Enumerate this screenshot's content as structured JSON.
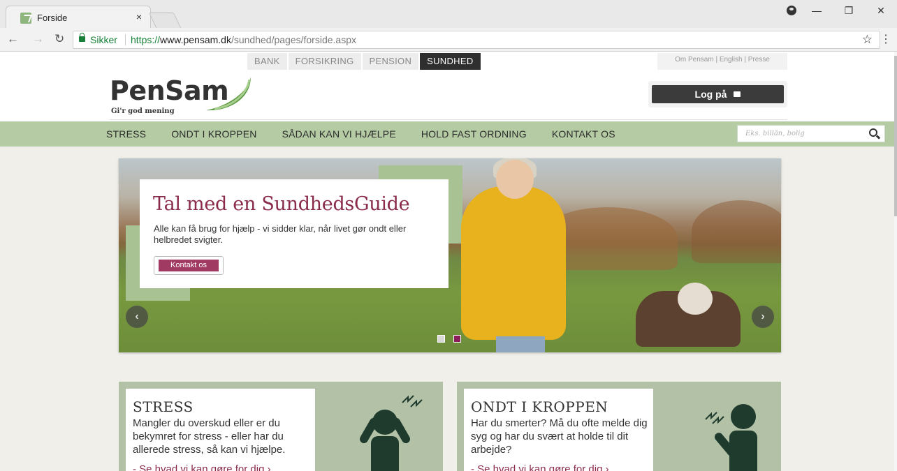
{
  "browser": {
    "tab_title": "Forside",
    "tab_close": "×",
    "secure_label": "Sikker",
    "url_scheme": "https://",
    "url_host": "www.pensam.dk",
    "url_path": "/sundhed/pages/forside.aspx",
    "window_controls": [
      "—",
      "❐",
      "✕"
    ]
  },
  "site": {
    "topnav": [
      "BANK",
      "FORSIKRING",
      "PENSION",
      "SUNDHED"
    ],
    "topnav_active": "SUNDHED",
    "utility_links": "Om Pensam  |  English  |  Presse",
    "logo_text": "PenSam",
    "logo_tagline": "Gi'r god mening",
    "login_label": "Log på",
    "mainnav": [
      "STRESS",
      "ONDT I KROPPEN",
      "SÅDAN KAN VI HJÆLPE",
      "HOLD FAST ORDNING",
      "KONTAKT OS"
    ],
    "search_placeholder": "Eks. billån, bolig"
  },
  "hero": {
    "title": "Tal med en SundhedsGuide",
    "text": "Alle kan få brug for hjælp - vi sidder klar, når livet gør ondt eller helbredet svigter.",
    "button": "Kontakt os",
    "active_slide": 2,
    "slide_count": 2
  },
  "cards": [
    {
      "title": "STRESS",
      "text": "Mangler du overskud eller er du bekymret for stress - eller har du allerede stress, så kan vi hjælpe.",
      "link": "- Se hvad vi kan gøre for dig ›"
    },
    {
      "title": "ONDT I KROPPEN",
      "text": "Har du smerter? Må du ofte melde dig syg og har du svært at holde til dit arbejde?",
      "link": "- Se hvad vi kan gøre for dig ›"
    }
  ],
  "colors": {
    "brand_green": "#b4cba4",
    "brand_plum": "#8a2b4a",
    "button_plum": "#a13a63",
    "login_dark": "#3b3b3b"
  }
}
